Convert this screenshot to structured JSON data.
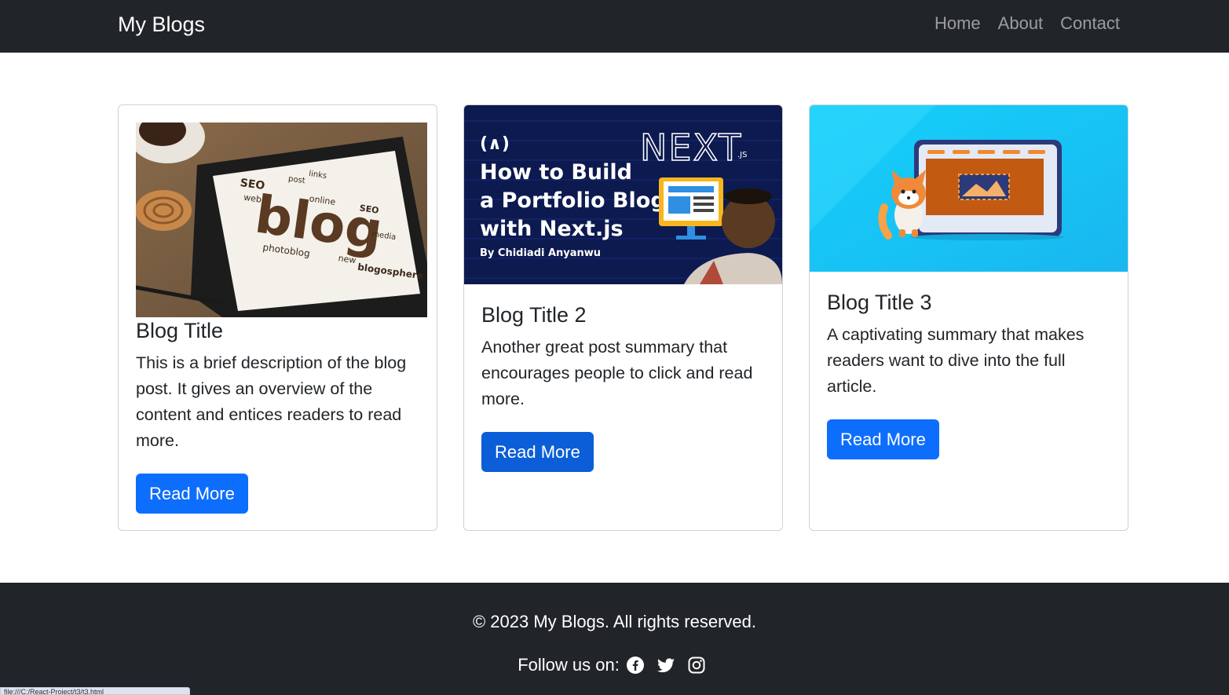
{
  "navbar": {
    "brand": "My Blogs",
    "links": [
      {
        "label": "Home"
      },
      {
        "label": "About"
      },
      {
        "label": "Contact"
      }
    ]
  },
  "cards": [
    {
      "title": "Blog Title",
      "text": "This is a brief description of the blog post. It gives an overview of the content and entices readers to read more.",
      "button": "Read More",
      "image_words": [
        "blog",
        "SEO",
        "web",
        "online",
        "photoblog",
        "blogosphere",
        "new",
        "media",
        "post",
        "links",
        "SEO"
      ]
    },
    {
      "title": "Blog Title 2",
      "text": "Another great post summary that encourages people to click and read more.",
      "button": "Read More",
      "image": {
        "logo_mark": "(∧)",
        "headline_lines": [
          "How to Build",
          "a Portfolio Blog",
          "with Next.js"
        ],
        "byline": "By Chidiadi Anyanwu",
        "brand": "NEXT",
        "brand_suffix": ".JS"
      }
    },
    {
      "title": "Blog Title 3",
      "text": "A captivating summary that makes readers want to dive into the full article.",
      "button": "Read More"
    }
  ],
  "footer": {
    "copyright": "© 2023 My Blogs. All rights reserved.",
    "follow_label": "Follow us on:",
    "social": [
      "facebook-icon",
      "twitter-icon",
      "instagram-icon"
    ]
  },
  "statusbar": {
    "url": "file:///C:/React-Project/t3/t3.html"
  },
  "colors": {
    "navbar_bg": "#212529",
    "primary": "#0d6efd",
    "footer_bg": "#212529"
  }
}
